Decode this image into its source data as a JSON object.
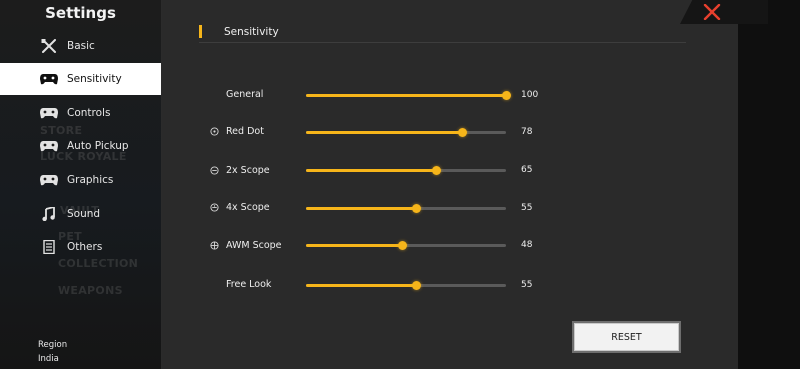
{
  "sidebar": {
    "title": "Settings",
    "items": [
      {
        "label": "Basic",
        "icon": "wrench-screwdriver-icon",
        "active": false
      },
      {
        "label": "Sensitivity",
        "icon": "gamepad-icon",
        "active": true
      },
      {
        "label": "Controls",
        "icon": "gamepad-icon",
        "active": false
      },
      {
        "label": "Auto Pickup",
        "icon": "gamepad-icon",
        "active": false
      },
      {
        "label": "Graphics",
        "icon": "gamepad-icon",
        "active": false
      },
      {
        "label": "Sound",
        "icon": "music-note-icon",
        "active": false
      },
      {
        "label": "Others",
        "icon": "document-icon",
        "active": false
      }
    ],
    "background_text": [
      "STORE",
      "LUCK ROYALE",
      "VAULT",
      "PET",
      "COLLECTION",
      "WEAPONS"
    ],
    "region_label": "Region",
    "region_value": "India"
  },
  "section": {
    "title": "Sensitivity"
  },
  "sliders": [
    {
      "label": "General",
      "value": 100,
      "icon": ""
    },
    {
      "label": "Red Dot",
      "value": 78,
      "icon": "red-dot-scope-icon"
    },
    {
      "label": "2x Scope",
      "value": 65,
      "icon": "2x-scope-icon"
    },
    {
      "label": "4x Scope",
      "value": 55,
      "icon": "4x-scope-icon"
    },
    {
      "label": "AWM Scope",
      "value": 48,
      "icon": "awm-scope-icon"
    },
    {
      "label": "Free Look",
      "value": 55,
      "icon": ""
    }
  ],
  "reset_label": "RESET",
  "colors": {
    "accent": "#f6b51a",
    "close": "#e8402e",
    "panel": "#2a2a2a",
    "active_item_bg": "#ffffff"
  }
}
